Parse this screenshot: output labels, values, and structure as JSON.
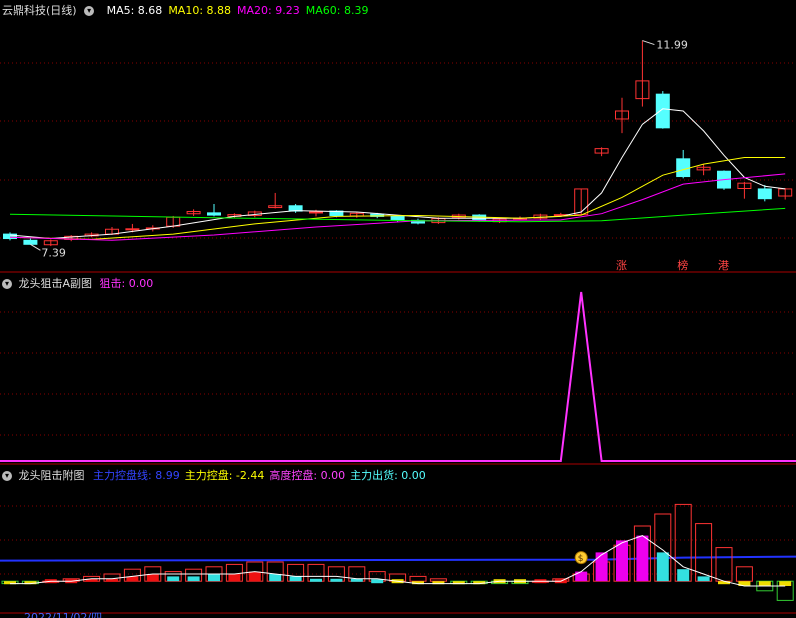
{
  "main_panel": {
    "title": "云鼎科技(日线)",
    "ma_labels": [
      {
        "label": "MA5: 8.68",
        "color": "#ffffff"
      },
      {
        "label": "MA10: 8.88",
        "color": "#ffff00"
      },
      {
        "label": "MA20: 9.23",
        "color": "#ff00ff"
      },
      {
        "label": "MA60: 8.39",
        "color": "#00ff00"
      }
    ],
    "high_label": "11.99",
    "low_label": "7.39",
    "markers": [
      "涨",
      "榜",
      "港"
    ]
  },
  "sub1": {
    "title": "龙头狙击A副图",
    "metric_label": "狙击: 0.00",
    "color": "#ff33ff"
  },
  "sub2": {
    "title": "龙头阻击附图",
    "metrics": [
      {
        "label": "主力控盘线: 8.99",
        "color": "#3344ff"
      },
      {
        "label": "主力控盘: -2.44",
        "color": "#ffff00"
      },
      {
        "label": "高度控盘: 0.00",
        "color": "#ff44ff"
      },
      {
        "label": "主力出货: 0.00",
        "color": "#55ffff"
      }
    ],
    "date_label": "2022/11/02/四",
    "coin_icon": "money-bag-icon"
  },
  "chart_data": [
    {
      "type": "candlestick",
      "title": "云鼎科技(日线)",
      "ylim": [
        6.9,
        12.5
      ],
      "candles": [
        {
          "o": 7.62,
          "c": 7.52,
          "h": 7.66,
          "l": 7.48
        },
        {
          "o": 7.48,
          "c": 7.39,
          "h": 7.52,
          "l": 7.39
        },
        {
          "o": 7.38,
          "c": 7.47,
          "h": 7.5,
          "l": 7.35
        },
        {
          "o": 7.5,
          "c": 7.57,
          "h": 7.6,
          "l": 7.46
        },
        {
          "o": 7.58,
          "c": 7.62,
          "h": 7.66,
          "l": 7.55
        },
        {
          "o": 7.62,
          "c": 7.73,
          "h": 7.78,
          "l": 7.6
        },
        {
          "o": 7.74,
          "c": 7.74,
          "h": 7.85,
          "l": 7.66
        },
        {
          "o": 7.76,
          "c": 7.76,
          "h": 7.82,
          "l": 7.68
        },
        {
          "o": 7.8,
          "c": 8.0,
          "h": 8.03,
          "l": 7.76
        },
        {
          "o": 8.08,
          "c": 8.13,
          "h": 8.18,
          "l": 8.03
        },
        {
          "o": 8.1,
          "c": 8.05,
          "h": 8.3,
          "l": 8.02
        },
        {
          "o": 8.02,
          "c": 8.06,
          "h": 8.09,
          "l": 7.98
        },
        {
          "o": 8.04,
          "c": 8.12,
          "h": 8.15,
          "l": 8.0
        },
        {
          "o": 8.22,
          "c": 8.26,
          "h": 8.55,
          "l": 8.2
        },
        {
          "o": 8.26,
          "c": 8.14,
          "h": 8.3,
          "l": 8.1
        },
        {
          "o": 8.12,
          "c": 8.12,
          "h": 8.17,
          "l": 8.02
        },
        {
          "o": 8.14,
          "c": 8.04,
          "h": 8.16,
          "l": 8.0
        },
        {
          "o": 8.03,
          "c": 8.09,
          "h": 8.12,
          "l": 7.99
        },
        {
          "o": 8.07,
          "c": 8.02,
          "h": 8.1,
          "l": 7.98
        },
        {
          "o": 8.02,
          "c": 7.94,
          "h": 8.05,
          "l": 7.9
        },
        {
          "o": 7.93,
          "c": 7.87,
          "h": 7.97,
          "l": 7.84
        },
        {
          "o": 7.88,
          "c": 7.97,
          "h": 8.0,
          "l": 7.85
        },
        {
          "o": 8.0,
          "c": 8.05,
          "h": 8.08,
          "l": 7.95
        },
        {
          "o": 8.05,
          "c": 7.92,
          "h": 8.07,
          "l": 7.9
        },
        {
          "o": 7.9,
          "c": 7.96,
          "h": 7.99,
          "l": 7.87
        },
        {
          "o": 7.98,
          "c": 7.98,
          "h": 8.02,
          "l": 7.94
        },
        {
          "o": 7.98,
          "c": 8.05,
          "h": 8.08,
          "l": 7.95
        },
        {
          "o": 8.06,
          "c": 8.06,
          "h": 8.1,
          "l": 8.02
        },
        {
          "o": 8.06,
          "c": 8.64,
          "h": 8.64,
          "l": 8.05
        },
        {
          "o": 9.45,
          "c": 9.55,
          "h": 9.58,
          "l": 9.38
        },
        {
          "o": 10.22,
          "c": 10.4,
          "h": 10.7,
          "l": 9.9
        },
        {
          "o": 10.68,
          "c": 11.08,
          "h": 11.99,
          "l": 10.5
        },
        {
          "o": 10.78,
          "c": 10.02,
          "h": 10.85,
          "l": 10.0
        },
        {
          "o": 9.32,
          "c": 8.92,
          "h": 9.52,
          "l": 8.88
        },
        {
          "o": 9.07,
          "c": 9.13,
          "h": 9.2,
          "l": 8.95
        },
        {
          "o": 9.04,
          "c": 8.66,
          "h": 9.06,
          "l": 8.62
        },
        {
          "o": 8.65,
          "c": 8.77,
          "h": 8.8,
          "l": 8.42
        },
        {
          "o": 8.64,
          "c": 8.42,
          "h": 8.73,
          "l": 8.36
        },
        {
          "o": 8.48,
          "c": 8.64,
          "h": 8.66,
          "l": 8.4
        }
      ],
      "ma_series": [
        {
          "name": "MA5",
          "color": "#ffffff",
          "points": [
            [
              0,
              7.6
            ],
            [
              2,
              7.52
            ],
            [
              5,
              7.62
            ],
            [
              8,
              7.8
            ],
            [
              11,
              8.02
            ],
            [
              14,
              8.15
            ],
            [
              17,
              8.12
            ],
            [
              21,
              7.98
            ],
            [
              25,
              7.98
            ],
            [
              27,
              8.02
            ],
            [
              28,
              8.12
            ],
            [
              29,
              8.55
            ],
            [
              30,
              9.35
            ],
            [
              31,
              10.1
            ],
            [
              32,
              10.45
            ],
            [
              33,
              10.4
            ],
            [
              34,
              9.95
            ],
            [
              35,
              9.4
            ],
            [
              36,
              8.9
            ],
            [
              37,
              8.7
            ],
            [
              38,
              8.64
            ]
          ]
        },
        {
          "name": "MA10",
          "color": "#ffff00",
          "points": [
            [
              0,
              7.55
            ],
            [
              4,
              7.5
            ],
            [
              8,
              7.62
            ],
            [
              12,
              7.85
            ],
            [
              16,
              8.02
            ],
            [
              20,
              8.04
            ],
            [
              25,
              7.98
            ],
            [
              28,
              8.05
            ],
            [
              30,
              8.45
            ],
            [
              32,
              8.95
            ],
            [
              34,
              9.2
            ],
            [
              36,
              9.35
            ],
            [
              38,
              9.35
            ]
          ]
        },
        {
          "name": "MA20",
          "color": "#ff00ff",
          "points": [
            [
              0,
              7.55
            ],
            [
              5,
              7.48
            ],
            [
              10,
              7.6
            ],
            [
              15,
              7.78
            ],
            [
              20,
              7.92
            ],
            [
              27,
              7.94
            ],
            [
              29,
              8.08
            ],
            [
              31,
              8.4
            ],
            [
              33,
              8.75
            ],
            [
              35,
              8.85
            ],
            [
              38,
              8.98
            ]
          ]
        },
        {
          "name": "MA60",
          "color": "#00ff00",
          "points": [
            [
              0,
              8.07
            ],
            [
              10,
              7.99
            ],
            [
              20,
              7.92
            ],
            [
              25,
              7.9
            ],
            [
              29,
              7.92
            ],
            [
              33,
              8.05
            ],
            [
              38,
              8.2
            ]
          ]
        }
      ]
    },
    {
      "type": "line",
      "title": "龙头狙击A副图",
      "series": [
        {
          "name": "狙击",
          "values": [
            0,
            0,
            0,
            0,
            0,
            0,
            0,
            0,
            0,
            0,
            0,
            0,
            0,
            0,
            0,
            0,
            0,
            0,
            0,
            0,
            0,
            0,
            0,
            0,
            0,
            0,
            0,
            0,
            1,
            0,
            0,
            0,
            0,
            0,
            0,
            0,
            0,
            0,
            0
          ]
        }
      ]
    },
    {
      "type": "bar",
      "title": "龙头阻击附图",
      "ylim": [
        -12,
        38
      ],
      "control_line": 8.99,
      "outline_bars": [
        -1,
        -1,
        0,
        1,
        2,
        3,
        5,
        6,
        4,
        5,
        6,
        7,
        8,
        8,
        7,
        7,
        6,
        6,
        4,
        3,
        2,
        1,
        -1,
        -1,
        -1,
        -1,
        0,
        1,
        3,
        8,
        15,
        23,
        28,
        32,
        24,
        14,
        6,
        -4,
        -8
      ],
      "filled_bars": [
        {
          "v": -1,
          "c": "yellow"
        },
        {
          "v": -1,
          "c": "yellow"
        },
        {
          "v": 0,
          "c": "red"
        },
        {
          "v": 0,
          "c": "red"
        },
        {
          "v": 1,
          "c": "red"
        },
        {
          "v": 1,
          "c": "red"
        },
        {
          "v": 2,
          "c": "red"
        },
        {
          "v": 3,
          "c": "red"
        },
        {
          "v": 2,
          "c": "cyan"
        },
        {
          "v": 2,
          "c": "cyan"
        },
        {
          "v": 3,
          "c": "cyan"
        },
        {
          "v": 3,
          "c": "red"
        },
        {
          "v": 4,
          "c": "red"
        },
        {
          "v": 3,
          "c": "cyan"
        },
        {
          "v": 2,
          "c": "cyan"
        },
        {
          "v": 1,
          "c": "cyan"
        },
        {
          "v": 1,
          "c": "cyan"
        },
        {
          "v": 1,
          "c": "cyan"
        },
        {
          "v": 0,
          "c": "cyan"
        },
        {
          "v": 0,
          "c": "yellow"
        },
        {
          "v": -1,
          "c": "yellow"
        },
        {
          "v": -1,
          "c": "yellow"
        },
        {
          "v": -1,
          "c": "yellow"
        },
        {
          "v": -1,
          "c": "yellow"
        },
        {
          "v": 0,
          "c": "yellow"
        },
        {
          "v": 0,
          "c": "yellow"
        },
        {
          "v": 0,
          "c": "red"
        },
        {
          "v": 0,
          "c": "red"
        },
        {
          "v": 4,
          "c": "magenta"
        },
        {
          "v": 12,
          "c": "magenta"
        },
        {
          "v": 17,
          "c": "magenta"
        },
        {
          "v": 19,
          "c": "magenta"
        },
        {
          "v": 12,
          "c": "cyan"
        },
        {
          "v": 5,
          "c": "cyan"
        },
        {
          "v": 2,
          "c": "cyan"
        },
        {
          "v": -1,
          "c": "yellow"
        },
        {
          "v": -2,
          "c": "yellow"
        },
        {
          "v": -2,
          "c": "yellow"
        },
        {
          "v": -2,
          "c": "yellow"
        }
      ],
      "trend_line": [
        -1,
        -1,
        0,
        0,
        1,
        1,
        2,
        3,
        3,
        3,
        3,
        3,
        4,
        3,
        2,
        2,
        2,
        1,
        1,
        0,
        -1,
        -1,
        -1,
        -1,
        0,
        0,
        0,
        0,
        4,
        11,
        16,
        19,
        13,
        6,
        3,
        0,
        -2,
        -2,
        -2
      ]
    }
  ]
}
